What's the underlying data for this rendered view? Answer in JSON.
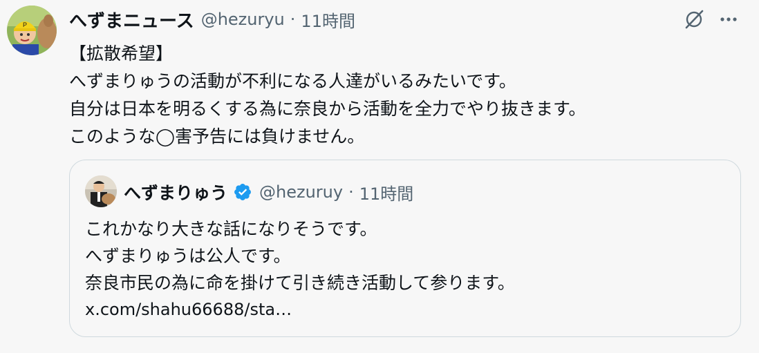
{
  "tweet": {
    "author_name": "へずまニュース",
    "author_handle": "@hezuryu",
    "separator": "·",
    "time": "11時間",
    "lines": [
      "【拡散希望】",
      "へずまりゅうの活動が不利になる人達がいるみたいです。",
      "自分は日本を明るくする為に奈良から活動を全力でやり抜きます。",
      "このような◯害予告には負けません。"
    ]
  },
  "quote": {
    "author_name": "へずまりゅう",
    "author_handle": "@hezuruy",
    "separator": "·",
    "time": "11時間",
    "lines": [
      "これかなり大きな話になりそうです。",
      "へずまりゅうは公人です。",
      "奈良市民の為に命を掛けて引き続き活動して参ります。"
    ],
    "link": "x.com/shahu66688/sta…"
  },
  "colors": {
    "text": "#0f1419",
    "secondary": "#536471",
    "verified": "#1d9bf0",
    "border": "#cfd9de",
    "background": "#f7f7f7"
  },
  "icons": {
    "grok": "grok-icon",
    "more": "more-options-icon",
    "verified": "verified-badge-icon"
  }
}
